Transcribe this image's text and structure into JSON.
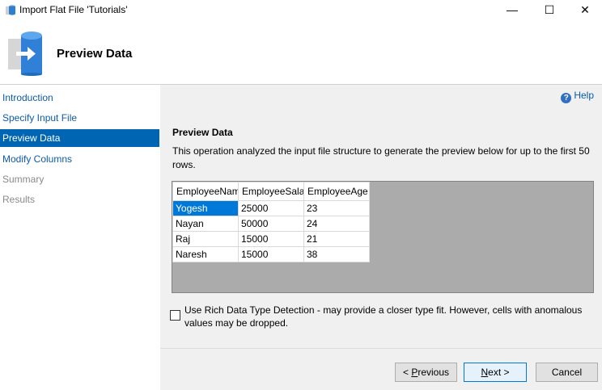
{
  "window": {
    "title": "Import Flat File 'Tutorials'",
    "controls": {
      "minimize": "—",
      "maximize": "☐",
      "close": "✕"
    }
  },
  "header": {
    "title": "Preview Data"
  },
  "sidebar": {
    "items": [
      {
        "label": "Introduction",
        "state": "link"
      },
      {
        "label": "Specify Input File",
        "state": "link"
      },
      {
        "label": "Preview Data",
        "state": "active"
      },
      {
        "label": "Modify Columns",
        "state": "link"
      },
      {
        "label": "Summary",
        "state": "disabled"
      },
      {
        "label": "Results",
        "state": "disabled"
      }
    ]
  },
  "help": {
    "label": "Help"
  },
  "main": {
    "section_title": "Preview Data",
    "description": "This operation analyzed the input file structure to generate the preview below for up to the first 50 rows.",
    "table": {
      "columns": [
        "EmployeeName",
        "EmployeeSalary",
        "EmployeeAge"
      ],
      "rows": [
        [
          "Yogesh",
          "25000",
          "23"
        ],
        [
          "Nayan",
          "50000",
          "24"
        ],
        [
          "Raj",
          "15000",
          "21"
        ],
        [
          "Naresh",
          "15000",
          "38"
        ]
      ]
    },
    "rich_detection": {
      "checked": false,
      "label": "Use Rich Data Type Detection - may provide a closer type fit. However, cells with anomalous values may be dropped."
    }
  },
  "footer": {
    "previous_mnemonic": "P",
    "previous_rest": "revious",
    "next_mnemonic": "N",
    "next_rest": "ext >",
    "cancel_label": "Cancel"
  },
  "colors": {
    "accent": "#0066b4",
    "selected_cell": "#0078d7",
    "link": "#0b5ba8",
    "grid_bg": "#ababab"
  }
}
